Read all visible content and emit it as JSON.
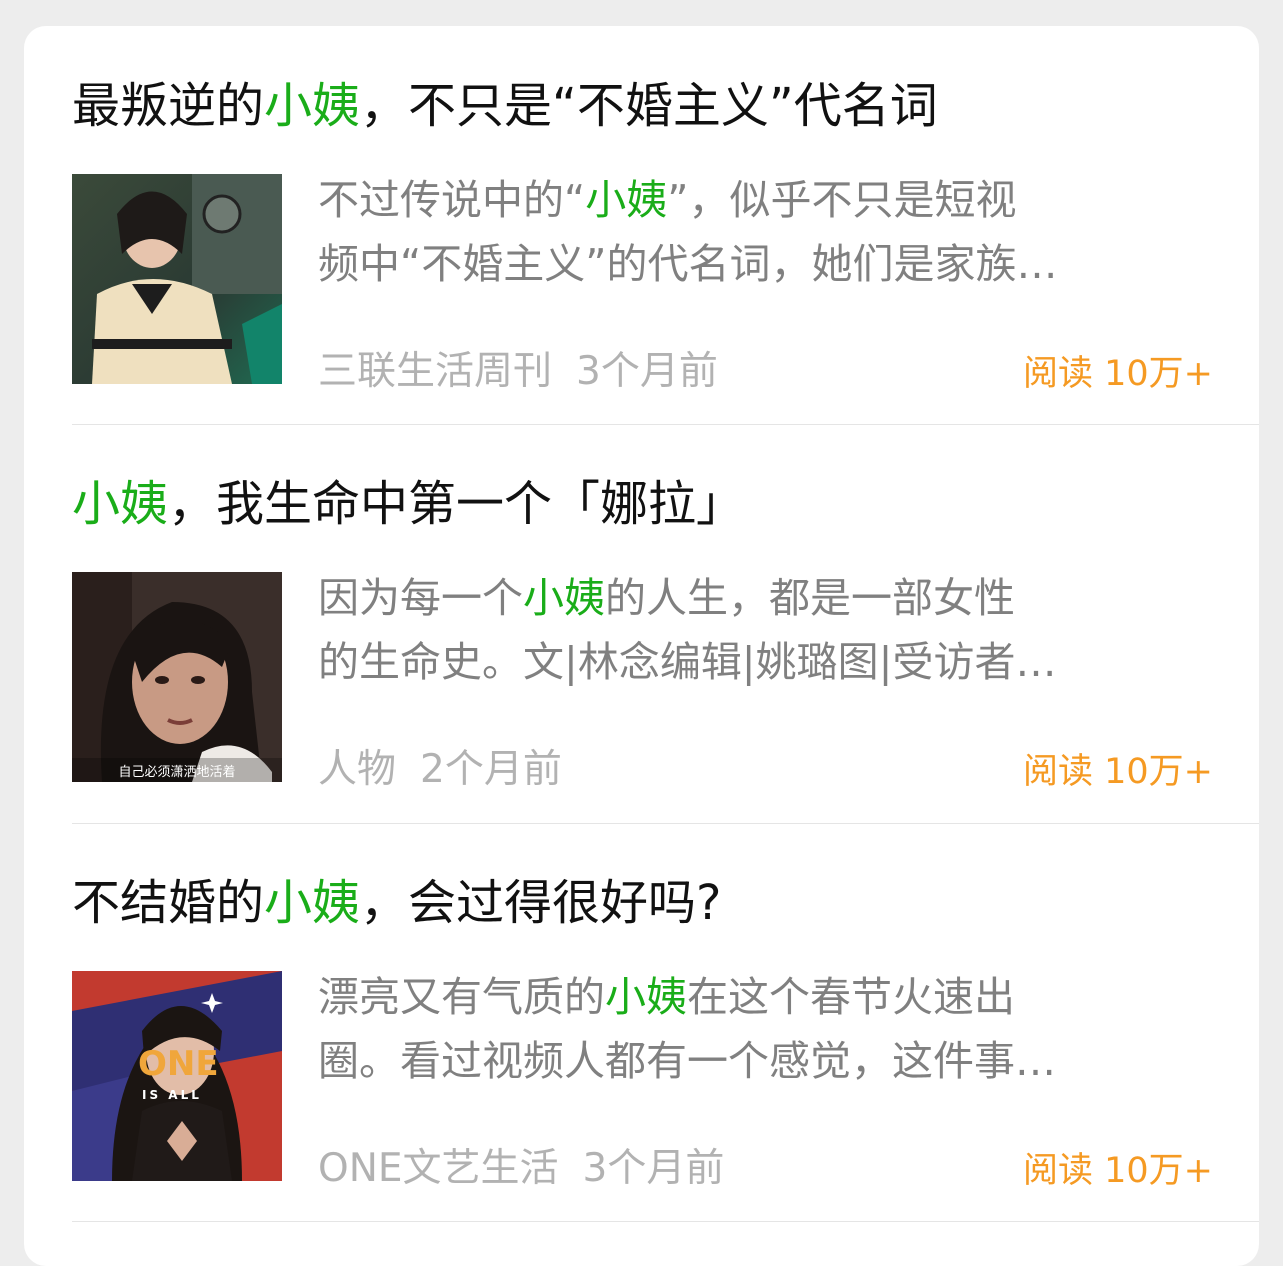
{
  "highlight_color": "#1aad19",
  "reads_color": "#f59a23",
  "articles": [
    {
      "title_prefix": "最叛逆的",
      "title_keyword": "小姨",
      "title_suffix": "，不只是“不婚主义”代名词",
      "summary_line1_prefix": "不过传说中的“",
      "summary_line1_keyword": "小姨",
      "summary_line1_suffix": "”，似乎不只是短视",
      "summary_line2": "频中“不婚主义”的代名词，她们是家族…",
      "source": "三联生活周刊",
      "time": "3个月前",
      "reads": "阅读 10万+",
      "thumb_icon": "woman-in-cream-jacket-photo"
    },
    {
      "title_prefix": "",
      "title_keyword": "小姨",
      "title_suffix": "，我生命中第一个「娜拉」",
      "summary_line1_prefix": "因为每一个",
      "summary_line1_keyword": "小姨",
      "summary_line1_suffix": "的人生，都是一部女性",
      "summary_line2": "的生命史。文|林念编辑|姚璐图|受访者…",
      "source": "人物",
      "time": "2个月前",
      "reads": "阅读 10万+",
      "thumb_caption": "自己必须潇洒地活着",
      "thumb_icon": "woman-portrait-photo"
    },
    {
      "title_prefix": "不结婚的",
      "title_keyword": "小姨",
      "title_suffix": "，会过得很好吗?",
      "summary_line1_prefix": "漂亮又有气质的",
      "summary_line1_keyword": "小姨",
      "summary_line1_suffix": "在这个春节火速出",
      "summary_line2": "圈。看过视频人都有一个感觉，这件事…",
      "source": "ONE文艺生活",
      "time": "3个月前",
      "reads": "阅读 10万+",
      "thumb_logo_one": "ONE",
      "thumb_logo_isall": "IS ALL",
      "thumb_icon": "one-is-all-poster-photo"
    }
  ]
}
